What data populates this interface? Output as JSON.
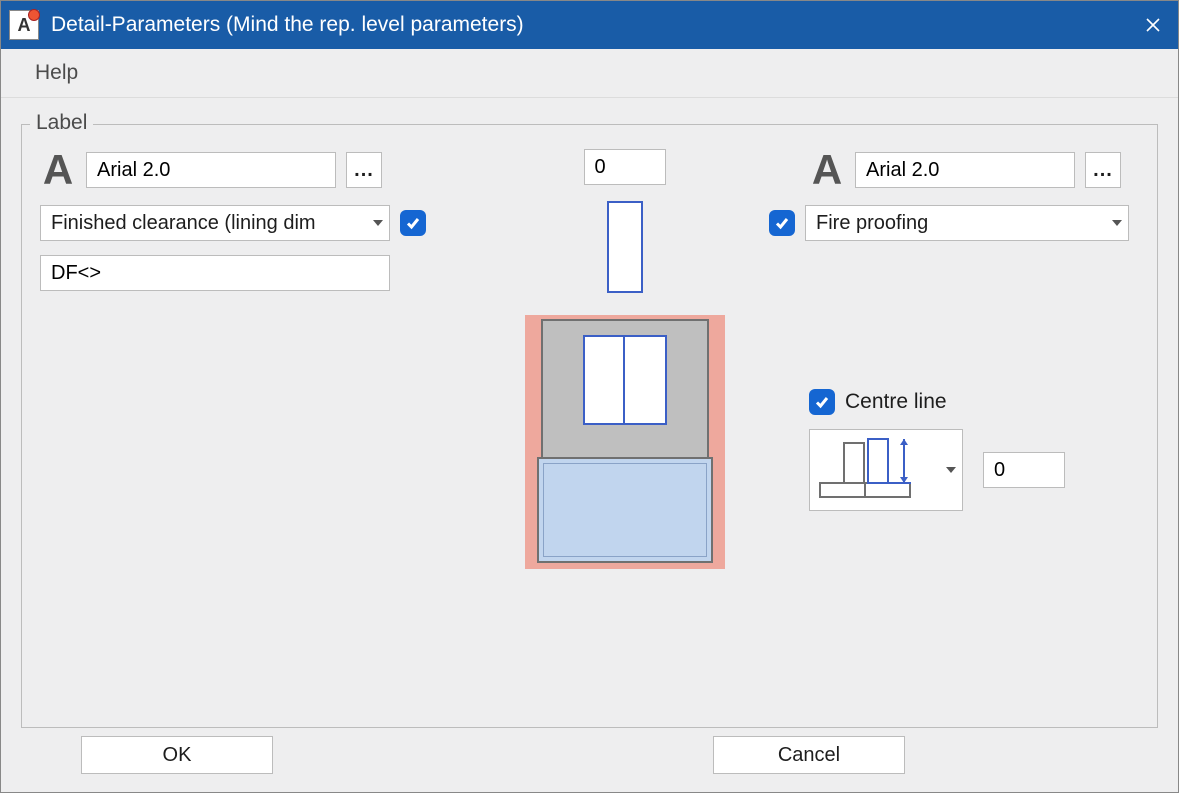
{
  "titlebar": {
    "app_icon_letter": "A",
    "title": "Detail-Parameters (Mind the rep. level parameters)"
  },
  "menu": {
    "help": "Help"
  },
  "group": {
    "legend": "Label"
  },
  "left": {
    "font_icon": "A",
    "font_value": "Arial 2.0",
    "ellipsis": "...",
    "select_value": "Finished clearance (lining dim",
    "check": true,
    "df_value": "DF<>"
  },
  "middle": {
    "top_value": "0"
  },
  "right": {
    "font_icon": "A",
    "font_value": "Arial 2.0",
    "ellipsis": "...",
    "check": true,
    "select_value": "Fire proofing",
    "centre_check": true,
    "centre_label": "Centre line",
    "centre_value": "0"
  },
  "footer": {
    "ok": "OK",
    "cancel": "Cancel"
  }
}
